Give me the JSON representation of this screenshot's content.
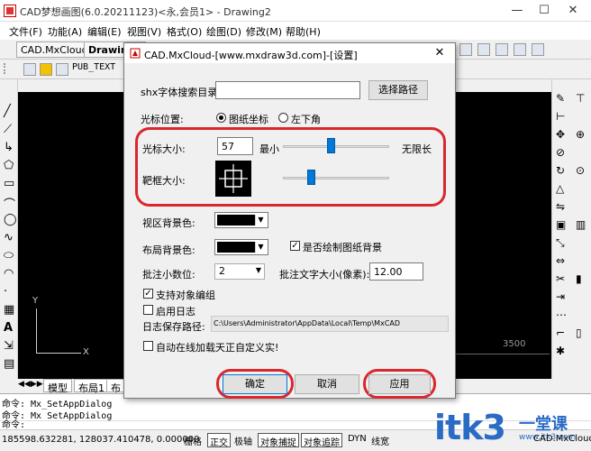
{
  "window": {
    "title": "CAD梦想画图(6.0.20211123)<永,会员1> - Drawing2",
    "minimize": "—",
    "maximize": "☐",
    "close": "✕"
  },
  "menu": [
    "文件(F)",
    "功能(A)",
    "编辑(E)",
    "视图(V)",
    "格式(O)",
    "绘图(D)",
    "修改(M)",
    "帮助(H)"
  ],
  "doc_tabs": [
    "CAD.MxCloud",
    "Drawing2"
  ],
  "layer": "PUB_TEXT",
  "layout_tabs": [
    "模型",
    "布局1",
    "布"
  ],
  "canvas": {
    "ruler_value": "3500",
    "ucs_y": "Y",
    "ucs_x": "X"
  },
  "command_lines": [
    "命令: Mx_SetAppDialog",
    "命令: Mx_SetAppDialog",
    "命令:"
  ],
  "status": {
    "coords": "185598.632281,  128037.410478,  0.000000",
    "buttons": [
      {
        "label": "栅格",
        "on": false
      },
      {
        "label": "正交",
        "on": true
      },
      {
        "label": "极轴",
        "on": false
      },
      {
        "label": "对象捕捉",
        "on": true
      },
      {
        "label": "对象追踪",
        "on": true
      },
      {
        "label": "DYN",
        "on": false
      },
      {
        "label": "线宽",
        "on": false
      }
    ],
    "app_label": "CAD.MxCloud"
  },
  "dialog": {
    "title": "CAD.MxCloud-[www.mxdraw3d.com]-[设置]",
    "close": "✕",
    "shx_label": "shx字体搜索目录:",
    "shx_value": "",
    "shx_button": "选择路径",
    "cursor_pos_label": "光标位置:",
    "cursor_pos_options": [
      "图纸坐标",
      "左下角"
    ],
    "cursor_pos_selected": 0,
    "cursor_size_label": "光标大小:",
    "cursor_size_value": "57",
    "cursor_size_min": "最小",
    "cursor_size_max": "无限长",
    "cursor_size_fraction": 0.45,
    "target_size_label": "靶框大小:",
    "target_size_fraction": 0.27,
    "viewport_bg_label": "视区背景色:",
    "viewport_bg_color": "#000000",
    "layout_bg_label": "布局背景色:",
    "layout_bg_color": "#000000",
    "draw_paper_bg_label": "是否绘制图纸背景",
    "draw_paper_bg_checked": true,
    "annot_decimals_label": "批注小数位:",
    "annot_decimals_value": "2",
    "annot_text_size_label": "批注文字大小(像素):",
    "annot_text_size_value": "12.00",
    "support_group_label": "支持对象编组",
    "support_group_checked": true,
    "enable_log_label": "启用日志",
    "enable_log_checked": false,
    "log_path_label": "日志保存路径:",
    "log_path_value": "C:\\Users\\Administrator\\AppData\\Local\\Temp\\MxCAD",
    "auto_load_label": "自动在线加载天正自定义实!",
    "auto_load_checked": false,
    "ok_button": "确定",
    "cancel_button": "取消",
    "apply_button": "应用"
  },
  "watermark": {
    "text": "itk3",
    "cn": "一堂课",
    "url": "www.itk3.com"
  },
  "colors": {
    "highlight_ring": "#d9272e",
    "slider": "#0078d7"
  }
}
